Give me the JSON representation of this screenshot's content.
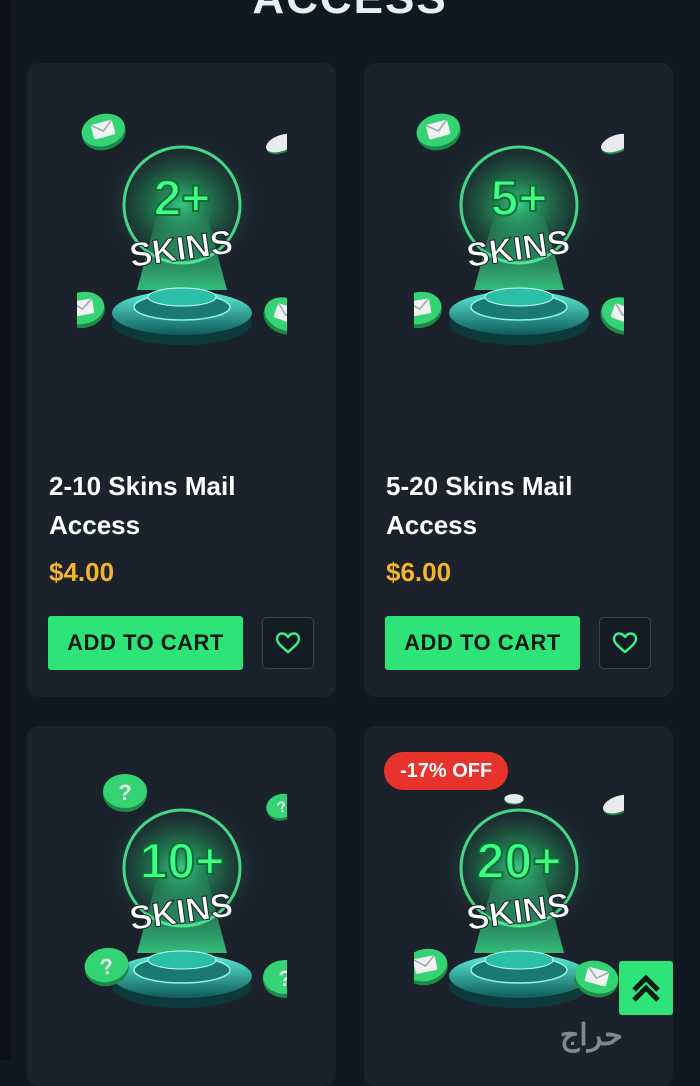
{
  "section": {
    "heading": "ACCESS"
  },
  "products": [
    {
      "skins_number": "2+",
      "skins_word": "SKINS",
      "title": "2-10 Skins Mail Access",
      "price": "$4.00",
      "cart_label": "ADD TO CART"
    },
    {
      "skins_number": "5+",
      "skins_word": "SKINS",
      "title": "5-20 Skins Mail Access",
      "price": "$6.00",
      "cart_label": "ADD TO CART"
    },
    {
      "skins_number": "10+",
      "skins_word": "SKINS"
    },
    {
      "skins_number": "20+",
      "skins_word": "SKINS",
      "badge": "-17% OFF"
    }
  ],
  "icons": {
    "wishlist": "heart-icon",
    "scroll_top": "chevron-up-icon",
    "coin_mail": "mail-coin-icon",
    "coin_question": "question-coin-icon"
  },
  "colors": {
    "background": "#121820",
    "card": "#1b222b",
    "accent": "#2ee478",
    "price": "#f5b52a",
    "badge": "#e8322c"
  },
  "watermark": "حراج"
}
